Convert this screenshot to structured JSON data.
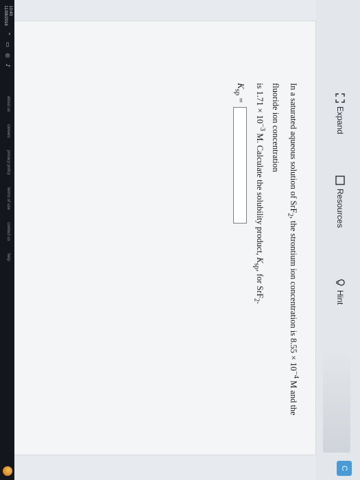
{
  "toolbar": {
    "expand_label": "Expand",
    "resources_label": "Resources",
    "hint_label": "Hint",
    "corner_label": "C"
  },
  "question": {
    "line1_prefix": "In a saturated aqueous solution of SrF",
    "line1_sub": "2",
    "line1_mid": ", the strontium ion concentration is 8.55 × 10",
    "line1_sup": "−4",
    "line1_suffix": " M and the fluoride ion concentration",
    "line2_prefix": "is 1.71 × 10",
    "line2_sup": "−3",
    "line2_mid": " M. Calculate the solubility product, ",
    "ksp_k": "K",
    "ksp_sub": "sp",
    "line2_for": ", for SrF",
    "line2_sub": "2",
    "line2_end": "."
  },
  "answer": {
    "label_k": "K",
    "label_sub": "sp",
    "label_eq": " =",
    "value": ""
  },
  "taskbar": {
    "time": "10:40",
    "date": "11/08/2016",
    "links": [
      "about us",
      "careers",
      "privacy policy",
      "terms of use",
      "contact us",
      "help"
    ]
  },
  "icons": {
    "expand": "expand-icon",
    "resources": "checkbox-icon",
    "hint": "lightbulb-icon"
  }
}
